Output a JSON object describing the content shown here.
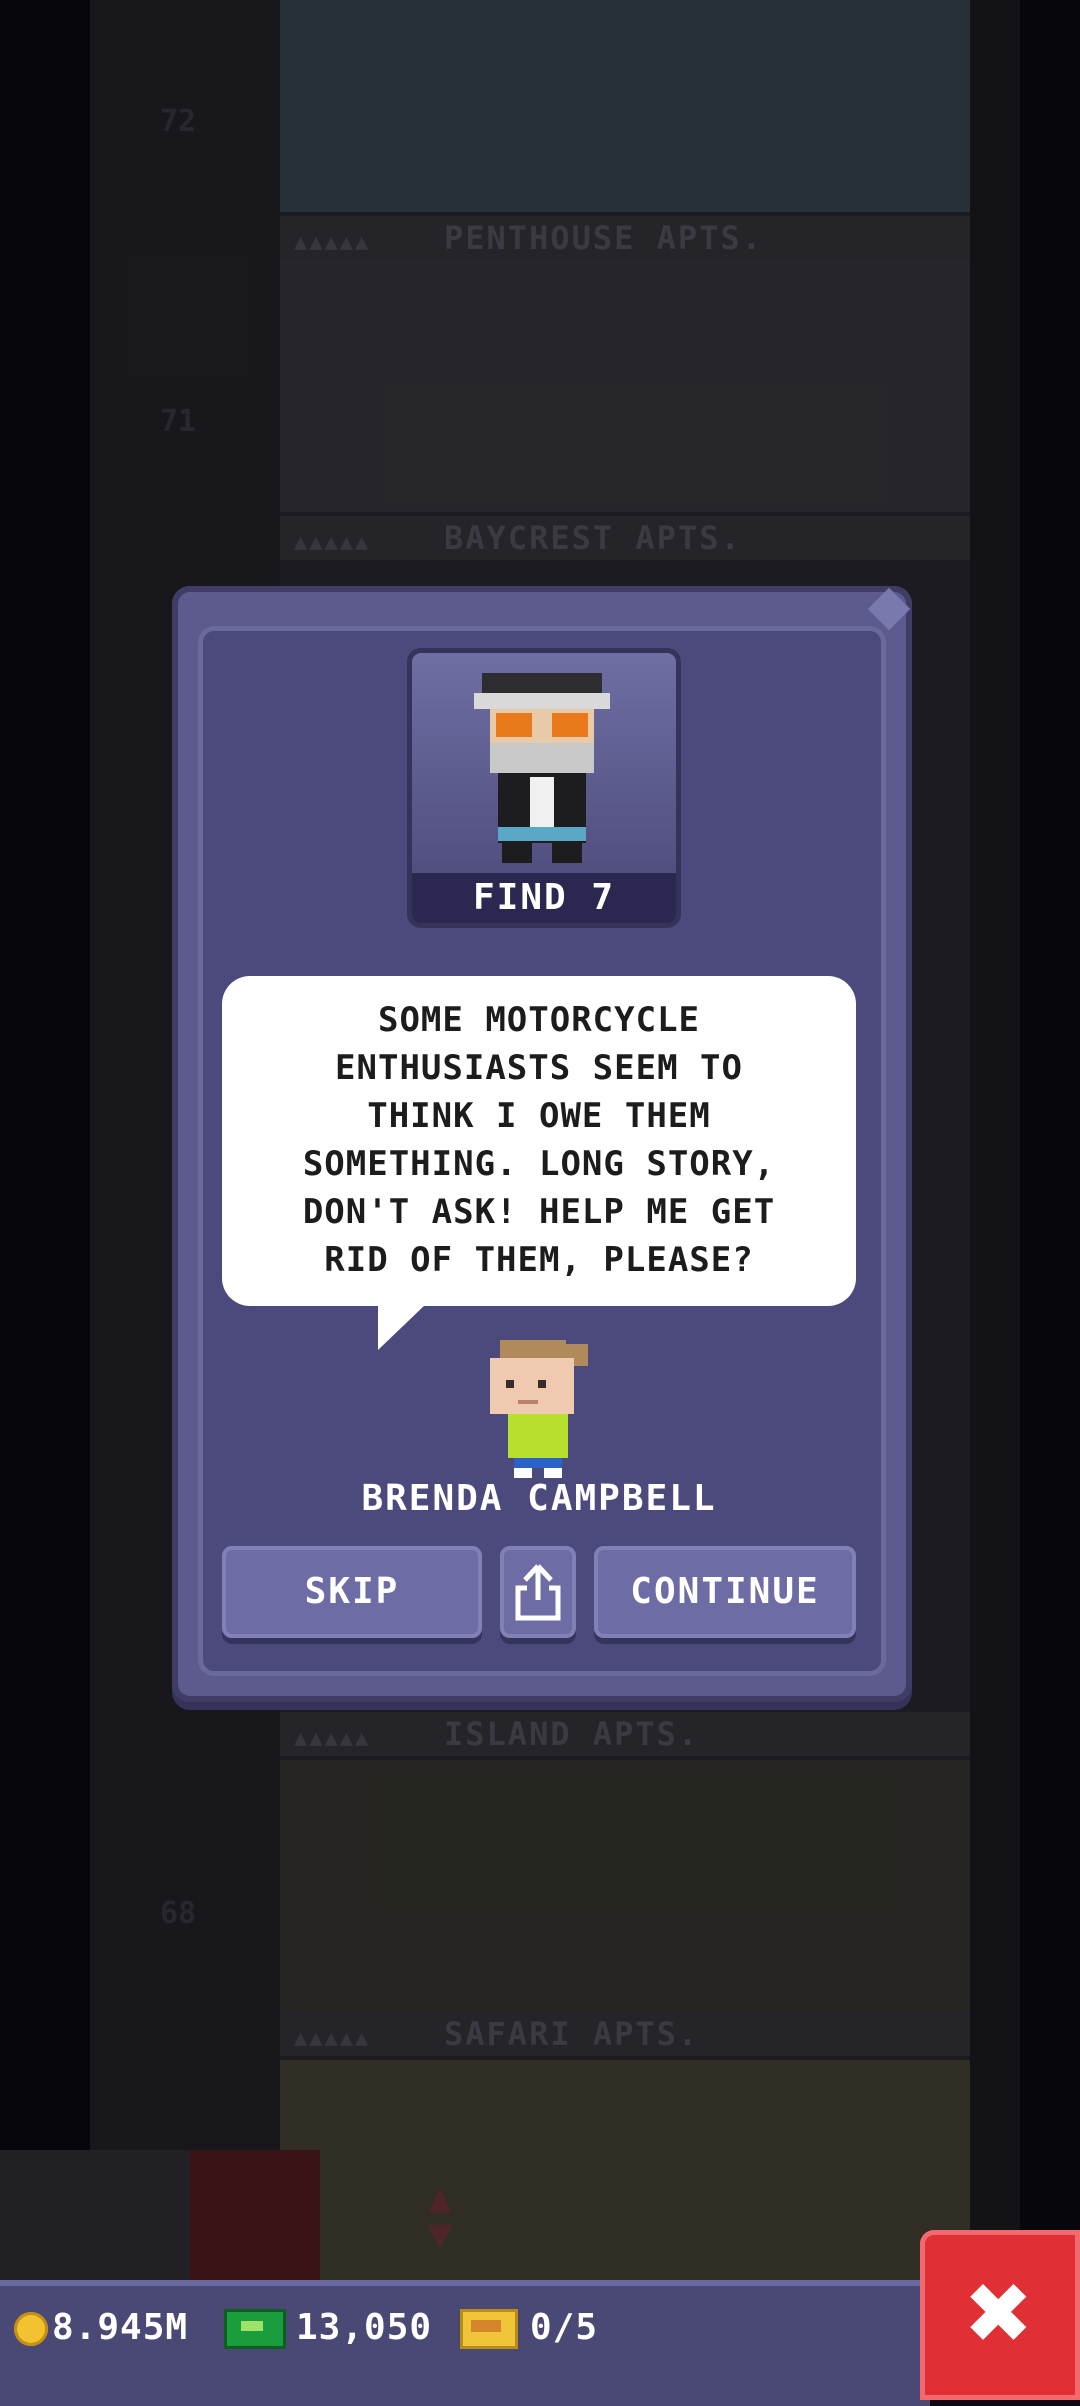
{
  "tower": {
    "floors": [
      {
        "number": "72",
        "label": "PENTHOUSE APTS."
      },
      {
        "number": "71",
        "label": "BAYCREST APTS."
      },
      {
        "number": "",
        "label": "ISLAND APTS."
      },
      {
        "number": "68",
        "label": "SAFARI APTS."
      }
    ]
  },
  "dialog": {
    "mission_label": "FIND 7",
    "message": "SOME MOTORCYCLE\nENTHUSIASTS SEEM TO\nTHINK I OWE THEM\nSOMETHING. LONG STORY,\nDON'T ASK! HELP ME GET\nRID OF THEM, PLEASE?",
    "speaker_name": "BRENDA CAMPBELL",
    "skip_label": "SKIP",
    "share_icon": "share-icon",
    "continue_label": "CONTINUE"
  },
  "status_bar": {
    "coins": "8.945M",
    "bux": "13,050",
    "tickets": "0/5",
    "coin_color": "#f2c230",
    "bux_color": "#1b9c3d"
  },
  "close_button": {
    "icon": "close-icon",
    "color": "#e03036"
  }
}
